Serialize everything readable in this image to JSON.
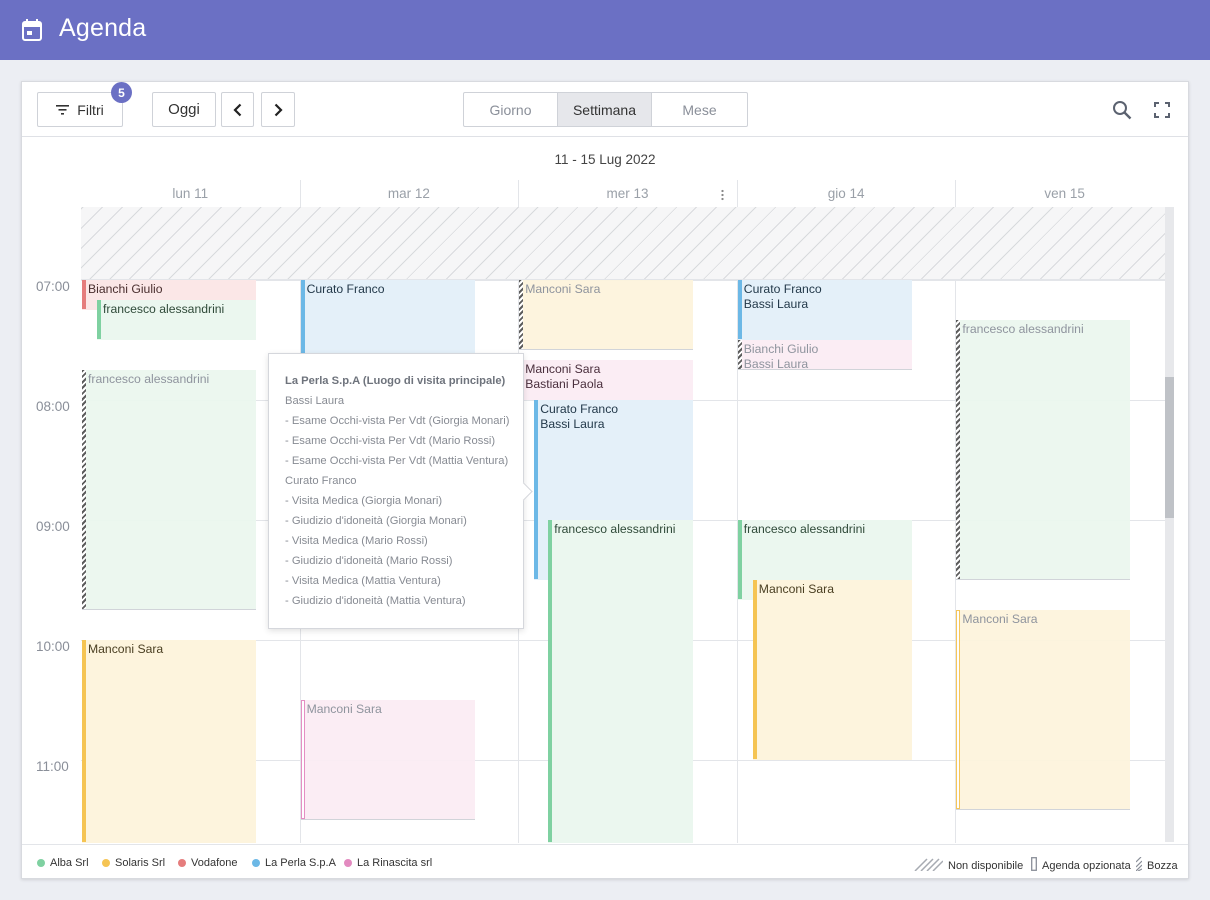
{
  "header": {
    "title": "Agenda",
    "icon": "calendar-icon"
  },
  "toolbar": {
    "filter_label": "Filtri",
    "filter_badge": "5",
    "today_label": "Oggi",
    "views": [
      {
        "label": "Giorno",
        "active": false
      },
      {
        "label": "Settimana",
        "active": true
      },
      {
        "label": "Mese",
        "active": false
      }
    ]
  },
  "calendar": {
    "range": "11 - 15 Lug 2022",
    "days": [
      "lun 11",
      "mar 12",
      "mer 13",
      "gio 14",
      "ven 15"
    ],
    "hours": [
      "07:00",
      "08:00",
      "09:00",
      "10:00",
      "11:00"
    ]
  },
  "events": [
    {
      "day": 0,
      "start": "07:00",
      "end": "07:15",
      "lines": [
        "Bianchi Giulio"
      ],
      "client": "Vodafone",
      "status": "confirmed"
    },
    {
      "day": 0,
      "start": "07:10",
      "end": "07:30",
      "lines": [
        "francesco alessandrini"
      ],
      "client": "Alba Srl",
      "status": "confirmed"
    },
    {
      "day": 0,
      "start": "07:45",
      "end": "09:45",
      "lines": [
        "francesco alessandrini"
      ],
      "client": "Alba Srl",
      "status": "draft"
    },
    {
      "day": 0,
      "start": "10:00",
      "end": "11:45",
      "lines": [
        "Manconi Sara"
      ],
      "client": "Solaris Srl",
      "status": "confirmed"
    },
    {
      "day": 1,
      "start": "07:00",
      "end": "07:45",
      "lines": [
        "Curato Franco"
      ],
      "client": "La Perla S.p.A",
      "status": "confirmed"
    },
    {
      "day": 1,
      "start": "10:30",
      "end": "11:30",
      "lines": [
        "Manconi Sara"
      ],
      "client": "La Rinascita srl",
      "status": "optional"
    },
    {
      "day": 2,
      "start": "07:00",
      "end": "07:35",
      "lines": [
        "Manconi Sara"
      ],
      "client": "Solaris Srl",
      "status": "draft"
    },
    {
      "day": 2,
      "start": "07:40",
      "end": "08:00",
      "lines": [
        "Manconi Sara",
        "Bastiani Paola"
      ],
      "client": "La Rinascita srl",
      "status": "confirmed"
    },
    {
      "day": 2,
      "start": "08:00",
      "end": "09:30",
      "lines": [
        "Curato Franco",
        "Bassi Laura"
      ],
      "client": "La Perla S.p.A",
      "status": "confirmed"
    },
    {
      "day": 2,
      "start": "09:00",
      "end": "11:45",
      "lines": [
        "francesco alessandrini"
      ],
      "client": "Alba Srl",
      "status": "confirmed"
    },
    {
      "day": 3,
      "start": "07:00",
      "end": "07:30",
      "lines": [
        "Curato Franco",
        "Bassi Laura"
      ],
      "client": "La Perla S.p.A",
      "status": "confirmed"
    },
    {
      "day": 3,
      "start": "07:30",
      "end": "07:45",
      "lines": [
        "Bianchi Giulio",
        "Bassi Laura"
      ],
      "client": "La Rinascita srl",
      "status": "draft"
    },
    {
      "day": 3,
      "start": "09:00",
      "end": "09:40",
      "lines": [
        "francesco alessandrini"
      ],
      "client": "Alba Srl",
      "status": "confirmed"
    },
    {
      "day": 3,
      "start": "09:30",
      "end": "11:00",
      "lines": [
        "Manconi Sara"
      ],
      "client": "Solaris Srl",
      "status": "confirmed"
    },
    {
      "day": 4,
      "start": "07:20",
      "end": "09:30",
      "lines": [
        "francesco alessandrini"
      ],
      "client": "Alba Srl",
      "status": "draft"
    },
    {
      "day": 4,
      "start": "09:45",
      "end": "11:25",
      "lines": [
        "Manconi Sara"
      ],
      "client": "Solaris Srl",
      "status": "optional"
    }
  ],
  "tooltip": {
    "title": "La Perla S.p.A (Luogo di visita principale)",
    "lines": [
      "Bassi Laura",
      "- Esame Occhi-vista Per Vdt (Giorgia Monari)",
      "- Esame Occhi-vista Per Vdt (Mario Rossi)",
      "- Esame Occhi-vista Per Vdt (Mattia Ventura)",
      "Curato Franco",
      "- Visita Medica (Giorgia Monari)",
      "- Giudizio d'idoneità (Giorgia Monari)",
      "- Visita Medica (Mario Rossi)",
      "- Giudizio d'idoneità (Mario Rossi)",
      "- Visita Medica (Mattia Ventura)",
      "- Giudizio d'idoneità (Mattia Ventura)"
    ]
  },
  "legend": {
    "clients": [
      {
        "label": "Alba Srl",
        "color": "#7fd1a1"
      },
      {
        "label": "Solaris Srl",
        "color": "#f5c453"
      },
      {
        "label": "Vodafone",
        "color": "#e57d7d"
      },
      {
        "label": "La Perla S.p.A",
        "color": "#6cb8e6"
      },
      {
        "label": "La Rinascita srl",
        "color": "#e38ac0"
      }
    ],
    "status": [
      {
        "label": "Non disponibile",
        "icon": "unavailable-hatch-icon"
      },
      {
        "label": "Agenda opzionata",
        "icon": "optional-bar-icon"
      },
      {
        "label": "Bozza",
        "icon": "draft-hatch-icon"
      }
    ]
  }
}
